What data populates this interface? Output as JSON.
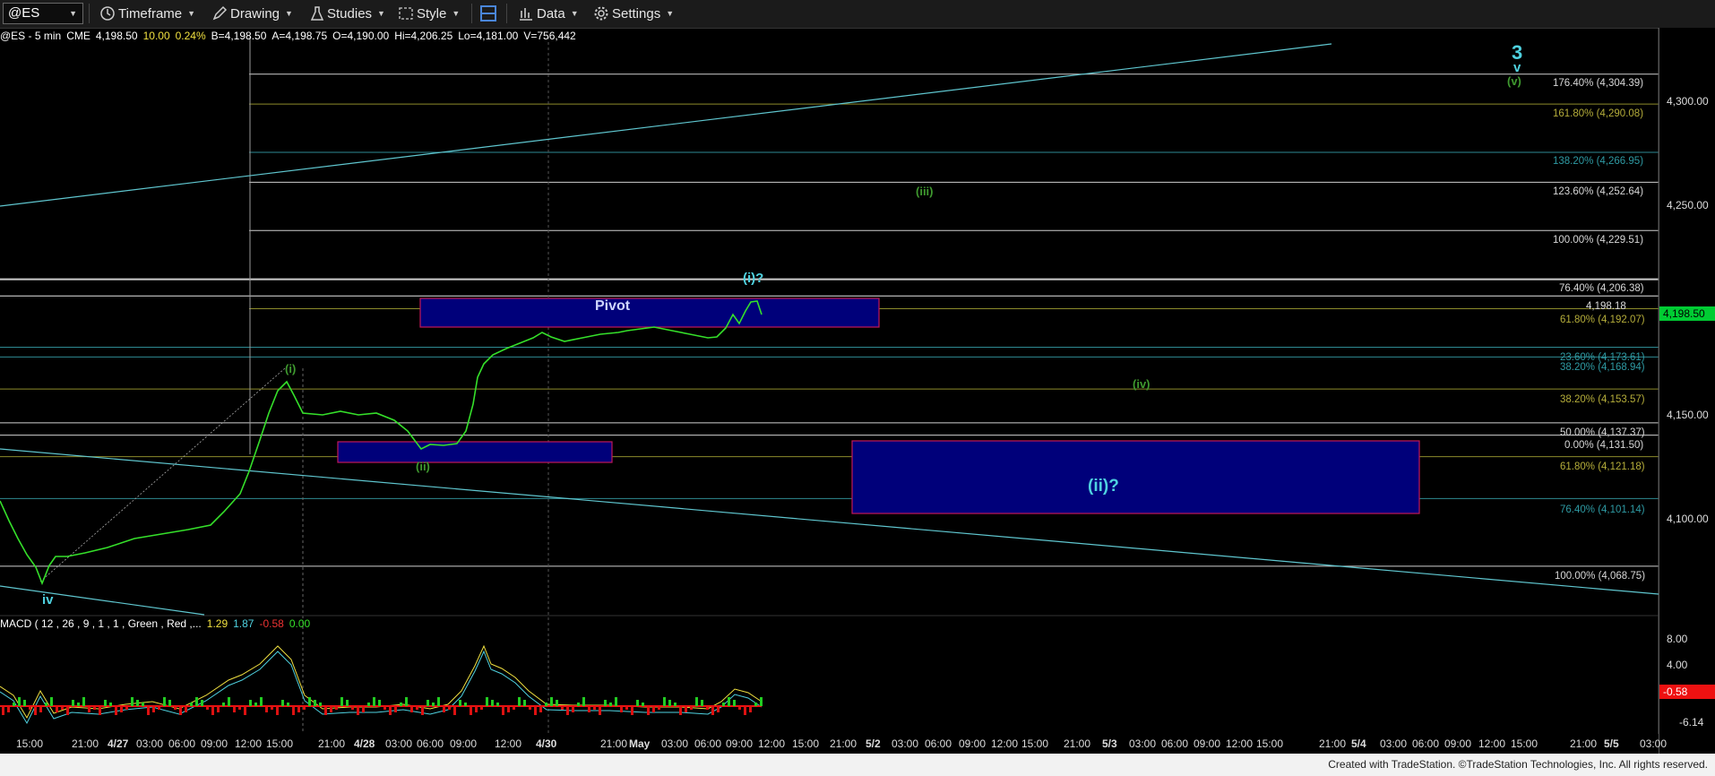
{
  "toolbar": {
    "symbol": "@ES",
    "timeframe": "Timeframe",
    "drawing": "Drawing",
    "studies": "Studies",
    "style": "Style",
    "data": "Data",
    "settings": "Settings"
  },
  "quote": {
    "name": "@ES - 5 min",
    "exchange": "CME",
    "last": "4,198.50",
    "change": "10.00",
    "change_pct": "0.24%",
    "bid": "B=4,198.50",
    "ask": "A=4,198.75",
    "open": "O=4,190.00",
    "high": "Hi=4,206.25",
    "low": "Lo=4,181.00",
    "volume": "V=756,442"
  },
  "price_axis": {
    "labels": [
      "4,300.00",
      "4,250.00",
      "4,150.00",
      "4,100.00"
    ],
    "current_price": "4,198.50",
    "line_price": "4,198.18"
  },
  "fib_levels": [
    {
      "text": "176.40% (4,304.39)",
      "color": "#d8d8d8"
    },
    {
      "text": "161.80% (4,290.08)",
      "color": "#b5ad3a"
    },
    {
      "text": "138.20% (4,266.95)",
      "color": "#2e9aa3"
    },
    {
      "text": "123.60% (4,252.64)",
      "color": "#d8d8d8"
    },
    {
      "text": "100.00% (4,229.51)",
      "color": "#d8d8d8"
    },
    {
      "text": "76.40% (4,206.38)",
      "color": "#d8d8d8"
    },
    {
      "text": "61.80% (4,192.07)",
      "color": "#b5ad3a"
    },
    {
      "text": "23.60% (4,173.61)",
      "color": "#2e9aa3"
    },
    {
      "text": "38.20% (4,168.94)",
      "color": "#2e9aa3"
    },
    {
      "text": "38.20% (4,153.57)",
      "color": "#b5ad3a"
    },
    {
      "text": "50.00% (4,137.37)",
      "color": "#d8d8d8"
    },
    {
      "text": "0.00% (4,131.50)",
      "color": "#d8d8d8"
    },
    {
      "text": "61.80% (4,121.18)",
      "color": "#b5ad3a"
    },
    {
      "text": "76.40% (4,101.14)",
      "color": "#2e9aa3"
    },
    {
      "text": "100.00% (4,068.75)",
      "color": "#d8d8d8"
    }
  ],
  "annotations": {
    "pivot": "Pivot",
    "wave_3": "3",
    "wave_v": "v",
    "wave_v_paren": "(v)",
    "wave_iii": "(iii)",
    "wave_i_q": "(i)?",
    "wave_i": "(i)",
    "wave_ii": "(ii)",
    "wave_iv_paren": "(iv)",
    "wave_ii_q": "(ii)?",
    "wave_iv": "iv"
  },
  "macd": {
    "label": "MACD ( 12 , 26 , 9 , 1 , 1 , Green , Red ,...",
    "v1": "1.29",
    "v2": "1.87",
    "v3": "-0.58",
    "v4": "0.00",
    "axis": [
      "8.00",
      "4.00",
      "-6.14"
    ],
    "current": "-0.58"
  },
  "time_axis": [
    {
      "t": "15:00",
      "b": false
    },
    {
      "t": "21:00",
      "b": false
    },
    {
      "t": "4/27",
      "b": true
    },
    {
      "t": "03:00",
      "b": false
    },
    {
      "t": "06:00",
      "b": false
    },
    {
      "t": "09:00",
      "b": false
    },
    {
      "t": "12:00",
      "b": false
    },
    {
      "t": "15:00",
      "b": false
    },
    {
      "t": "21:00",
      "b": false
    },
    {
      "t": "4/28",
      "b": true
    },
    {
      "t": "03:00",
      "b": false
    },
    {
      "t": "06:00",
      "b": false
    },
    {
      "t": "09:00",
      "b": false
    },
    {
      "t": "12:00",
      "b": false
    },
    {
      "t": "4/30",
      "b": true
    },
    {
      "t": "21:00",
      "b": false
    },
    {
      "t": "May",
      "b": true
    },
    {
      "t": "03:00",
      "b": false
    },
    {
      "t": "06:00",
      "b": false
    },
    {
      "t": "09:00",
      "b": false
    },
    {
      "t": "12:00",
      "b": false
    },
    {
      "t": "15:00",
      "b": false
    },
    {
      "t": "21:00",
      "b": false
    },
    {
      "t": "5/2",
      "b": true
    },
    {
      "t": "03:00",
      "b": false
    },
    {
      "t": "06:00",
      "b": false
    },
    {
      "t": "09:00",
      "b": false
    },
    {
      "t": "12:00",
      "b": false
    },
    {
      "t": "15:00",
      "b": false
    },
    {
      "t": "21:00",
      "b": false
    },
    {
      "t": "5/3",
      "b": true
    },
    {
      "t": "03:00",
      "b": false
    },
    {
      "t": "06:00",
      "b": false
    },
    {
      "t": "09:00",
      "b": false
    },
    {
      "t": "12:00",
      "b": false
    },
    {
      "t": "15:00",
      "b": false
    },
    {
      "t": "21:00",
      "b": false
    },
    {
      "t": "5/4",
      "b": true
    },
    {
      "t": "03:00",
      "b": false
    },
    {
      "t": "06:00",
      "b": false
    },
    {
      "t": "09:00",
      "b": false
    },
    {
      "t": "12:00",
      "b": false
    },
    {
      "t": "15:00",
      "b": false
    },
    {
      "t": "21:00",
      "b": false
    },
    {
      "t": "5/5",
      "b": true
    },
    {
      "t": "03:00",
      "b": false
    }
  ],
  "footer": "Created with TradeStation. ©TradeStation Technologies, Inc. All rights reserved.",
  "colors": {
    "price_line": "#35e02a",
    "pivot_fill": "#00007a",
    "pivot_border": "#c0185a",
    "teal_line": "#5fc6cf",
    "olive_line": "#8c8a2b",
    "wave_green": "#3f9a2f",
    "wave_teal": "#4fd2e0"
  }
}
